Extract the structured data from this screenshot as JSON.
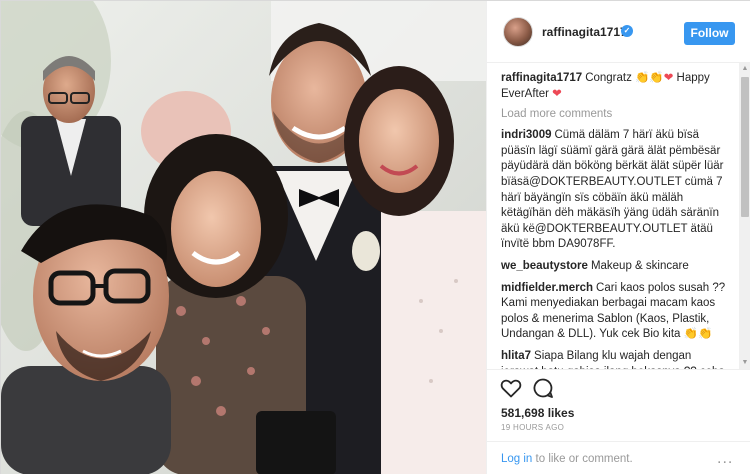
{
  "post": {
    "username": "raffinagita1717",
    "follow_label": "Follow",
    "likes": "581,698 likes",
    "time": "19 HOURS AGO",
    "login_link": "Log in",
    "login_rest": " to like or comment.",
    "more_label": "..."
  },
  "comments": {
    "caption": {
      "author": "raffinagita1717",
      "text_a": "Congratz ",
      "emoji_a": "👏👏",
      "heart_a": "❤",
      "text_b": " Happy EverAfter ",
      "heart_b": "❤"
    },
    "load_more": "Load more comments",
    "items": [
      {
        "author": "indri3009",
        "text": "Cümä däläm 7 härï äkü bïsä püäsïn lägï süämï gärä gärä älät pëmbësär päyüdärä dän bököng bërkät älät süpër lüär bïäsä@DOKTERBEAUTY.OUTLET cümä 7 härï bäyängïn sïs cöbäïn äkü mäläh këtägïhän dëh mäkäsïh ÿäng üdäh säränïn äkü kë@DOKTERBEAUTY.OUTLET ätäü ïnvïtë bbm DA9078FF."
      },
      {
        "author": "we_beautystore",
        "text": "Makeup & skincare"
      },
      {
        "author": "midfielder.merch",
        "text": "Cari kaos polos susah ?? Kami menyediakan berbagai macam kaos polos & menerima Sablon (Kaos, Plastik, Undangan & DLL). Yuk cek Bio kita ",
        "emoji": "👏👏"
      },
      {
        "author": "hlita7",
        "text": "Siapa Bilang klu wajah dengan jerawat batu gabisa ilang bekasnya ?? coba deh tanya ke@amazingmasker nih juga"
      }
    ]
  },
  "colors": {
    "accent": "#3897f0",
    "heart": "#ed4956",
    "muted": "#999999",
    "text": "#262626"
  },
  "icons": [
    "heart-outline-icon",
    "comment-bubble-icon",
    "verified-badge-icon",
    "more-dots-icon",
    "scroll-up-icon",
    "scroll-down-icon"
  ]
}
